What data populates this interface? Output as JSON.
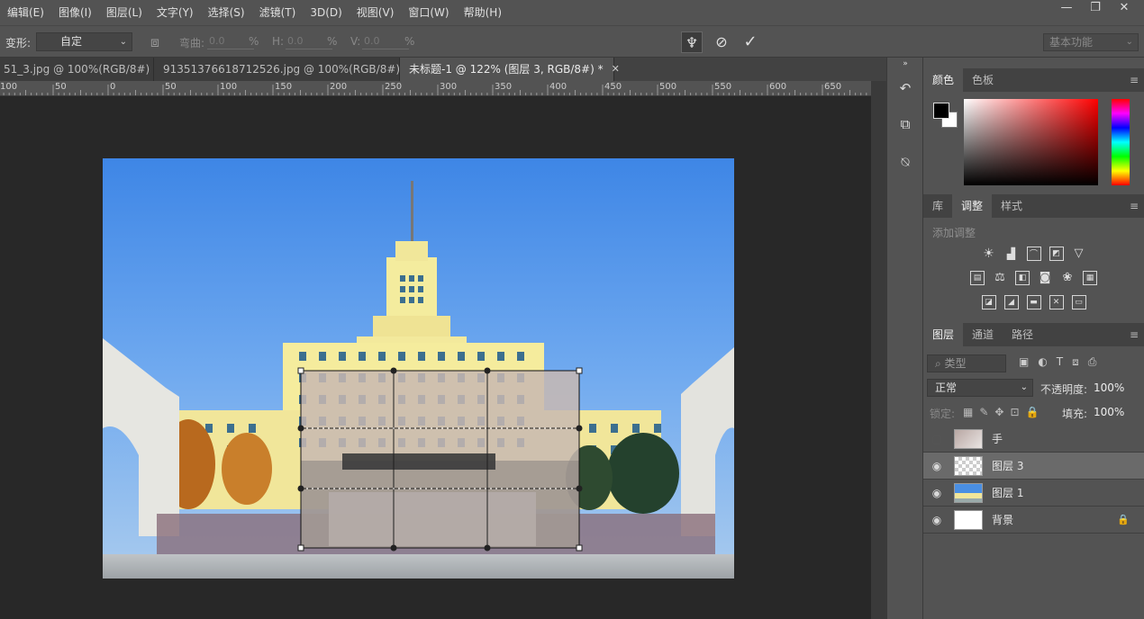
{
  "menu": [
    "编辑(E)",
    "图像(I)",
    "图层(L)",
    "文字(Y)",
    "选择(S)",
    "滤镜(T)",
    "3D(D)",
    "视图(V)",
    "窗口(W)",
    "帮助(H)"
  ],
  "window_controls": [
    "—",
    "❐",
    "✕"
  ],
  "options": {
    "transform_label": "变形:",
    "transform_value": "自定",
    "bend_label": "弯曲:",
    "bend_value": "0.0",
    "h_label": "H:",
    "h_value": "0.0",
    "v_label": "V:",
    "v_value": "0.0",
    "pct": "%",
    "workspace": "基本功能"
  },
  "tabs": [
    {
      "label": "51_3.jpg @ 100%(RGB/8#)",
      "close": "✕"
    },
    {
      "label": "91351376618712526.jpg @ 100%(RGB/8#)",
      "close": "✕"
    },
    {
      "label": "未标题-1 @ 122% (图层 3, RGB/8#) *",
      "close": "✕"
    }
  ],
  "ruler_ticks": [
    "100",
    "50",
    "0",
    "50",
    "100",
    "150",
    "200",
    "250",
    "300",
    "350",
    "400",
    "450",
    "500",
    "550",
    "600",
    "650"
  ],
  "color_panel": {
    "tabs": [
      "颜色",
      "色板"
    ]
  },
  "adjust_panel": {
    "tabs": [
      "库",
      "调整",
      "样式"
    ],
    "title": "添加调整"
  },
  "layers_panel": {
    "tabs": [
      "图层",
      "通道",
      "路径"
    ],
    "kind_filter": "类型",
    "blend_mode": "正常",
    "opacity_label": "不透明度:",
    "opacity": "100%",
    "lock_label": "锁定:",
    "fill_label": "填充:",
    "fill": "100%",
    "layers": [
      {
        "name": "手",
        "visible": false,
        "selected": false
      },
      {
        "name": "图层 3",
        "visible": true,
        "selected": true
      },
      {
        "name": "图层 1",
        "visible": true,
        "selected": false
      },
      {
        "name": "背景",
        "visible": true,
        "selected": false,
        "locked": true
      }
    ]
  },
  "colors": {
    "foreground": "#000000",
    "background": "#ffffff",
    "accent_hue": "#ff0000"
  }
}
